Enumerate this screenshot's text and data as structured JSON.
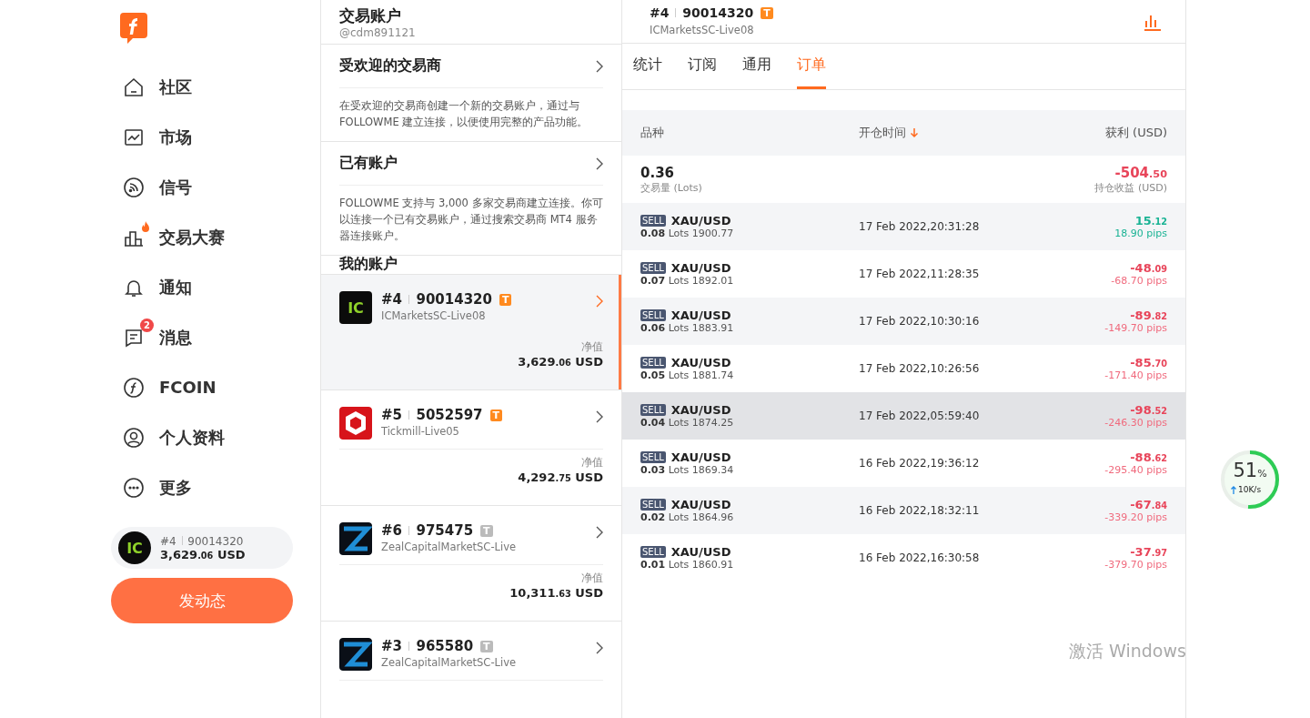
{
  "nav": [
    {
      "label": "社区",
      "hot": false
    },
    {
      "label": "市场",
      "hot": false
    },
    {
      "label": "信号",
      "hot": false
    },
    {
      "label": "交易大赛",
      "hot": true
    },
    {
      "label": "通知",
      "hot": false
    },
    {
      "label": "消息",
      "hot": false,
      "badge": "2"
    },
    {
      "label": "FCOIN",
      "hot": false
    },
    {
      "label": "个人资料",
      "hot": false
    },
    {
      "label": "更多",
      "hot": false
    }
  ],
  "current_account": {
    "logo_text": "IC",
    "number": "#4",
    "id": "90014320",
    "int": "3,629",
    "dec": ".06",
    "currency": "USD"
  },
  "post_button": "发动态",
  "accounts_panel": {
    "title": "交易账户",
    "handle": "@cdm891121",
    "sections": [
      {
        "title": "受欢迎的交易商",
        "text": "在受欢迎的交易商创建一个新的交易账户，通过与 FOLLOWME 建立连接，以便使用完整的产品功能。"
      },
      {
        "title": "已有账户",
        "text": "FOLLOWME 支持与 3,000 多家交易商建立连接。你可以连接一个已有交易账户，通过搜索交易商 MT4 服务器连接账户。"
      }
    ],
    "my_title": "我的账户",
    "accounts": [
      {
        "kind": "text",
        "logo_text": "IC",
        "number": "#4",
        "id": "90014320",
        "tag": "T",
        "tag_active": true,
        "server": "ICMarketsSC-Live08",
        "equity_label": "净值",
        "int": "3,629",
        "dec": ".06",
        "currency": "USD",
        "selected": true
      },
      {
        "kind": "hexagon",
        "number": "#5",
        "id": "5052597",
        "tag": "T",
        "tag_active": true,
        "server": "Tickmill-Live05",
        "equity_label": "净值",
        "int": "4,292",
        "dec": ".75",
        "currency": "USD",
        "selected": false
      },
      {
        "kind": "stripe",
        "number": "#6",
        "id": "975475",
        "tag": "T",
        "tag_active": false,
        "server": "ZealCapitalMarketSC-Live",
        "equity_label": "净值",
        "int": "10,311",
        "dec": ".63",
        "currency": "USD",
        "selected": false
      },
      {
        "kind": "stripe",
        "number": "#3",
        "id": "965580",
        "tag": "T",
        "tag_active": false,
        "server": "ZealCapitalMarketSC-Live",
        "selected": false
      }
    ]
  },
  "detail": {
    "number": "#4",
    "id": "90014320",
    "tag": "T",
    "server": "ICMarketsSC-Live08",
    "tabs": [
      {
        "label": "统计",
        "selected": false
      },
      {
        "label": "订阅",
        "selected": false
      },
      {
        "label": "通用",
        "selected": false
      },
      {
        "label": "订单",
        "selected": true
      }
    ],
    "columns": [
      "品种",
      "开仓时间",
      "获利 (USD)"
    ],
    "summary": {
      "lots": "0.36",
      "lots_label": "交易量 (Lots)",
      "int": "-504",
      "dec": ".50",
      "profit_label": "持仓收益 (USD)"
    },
    "orders": [
      {
        "side": "SELL",
        "symbol": "XAU/USD",
        "lots": "0.08",
        "lots_unit": "Lots",
        "price": "1900.77",
        "time": "17 Feb 2022,20:31:28",
        "int": "15",
        "dec": ".12",
        "pips": "18.90 pips",
        "positive": true,
        "highlighted": false
      },
      {
        "side": "SELL",
        "symbol": "XAU/USD",
        "lots": "0.07",
        "lots_unit": "Lots",
        "price": "1892.01",
        "time": "17 Feb 2022,11:28:35",
        "int": "-48",
        "dec": ".09",
        "pips": "-68.70 pips",
        "positive": false,
        "highlighted": false
      },
      {
        "side": "SELL",
        "symbol": "XAU/USD",
        "lots": "0.06",
        "lots_unit": "Lots",
        "price": "1883.91",
        "time": "17 Feb 2022,10:30:16",
        "int": "-89",
        "dec": ".82",
        "pips": "-149.70 pips",
        "positive": false,
        "highlighted": false
      },
      {
        "side": "SELL",
        "symbol": "XAU/USD",
        "lots": "0.05",
        "lots_unit": "Lots",
        "price": "1881.74",
        "time": "17 Feb 2022,10:26:56",
        "int": "-85",
        "dec": ".70",
        "pips": "-171.40 pips",
        "positive": false,
        "highlighted": false
      },
      {
        "side": "SELL",
        "symbol": "XAU/USD",
        "lots": "0.04",
        "lots_unit": "Lots",
        "price": "1874.25",
        "time": "17 Feb 2022,05:59:40",
        "int": "-98",
        "dec": ".52",
        "pips": "-246.30 pips",
        "positive": false,
        "highlighted": true
      },
      {
        "side": "SELL",
        "symbol": "XAU/USD",
        "lots": "0.03",
        "lots_unit": "Lots",
        "price": "1869.34",
        "time": "16 Feb 2022,19:36:12",
        "int": "-88",
        "dec": ".62",
        "pips": "-295.40 pips",
        "positive": false,
        "highlighted": false
      },
      {
        "side": "SELL",
        "symbol": "XAU/USD",
        "lots": "0.02",
        "lots_unit": "Lots",
        "price": "1864.96",
        "time": "16 Feb 2022,18:32:11",
        "int": "-67",
        "dec": ".84",
        "pips": "-339.20 pips",
        "positive": false,
        "highlighted": false
      },
      {
        "side": "SELL",
        "symbol": "XAU/USD",
        "lots": "0.01",
        "lots_unit": "Lots",
        "price": "1860.91",
        "time": "16 Feb 2022,16:30:58",
        "int": "-37",
        "dec": ".97",
        "pips": "-379.70 pips",
        "positive": false,
        "highlighted": false
      }
    ]
  },
  "speed_widget": {
    "percent": "51",
    "unit": "%",
    "level": 0.51,
    "rate": "10K/s"
  },
  "os_notice": "激活 Windows"
}
